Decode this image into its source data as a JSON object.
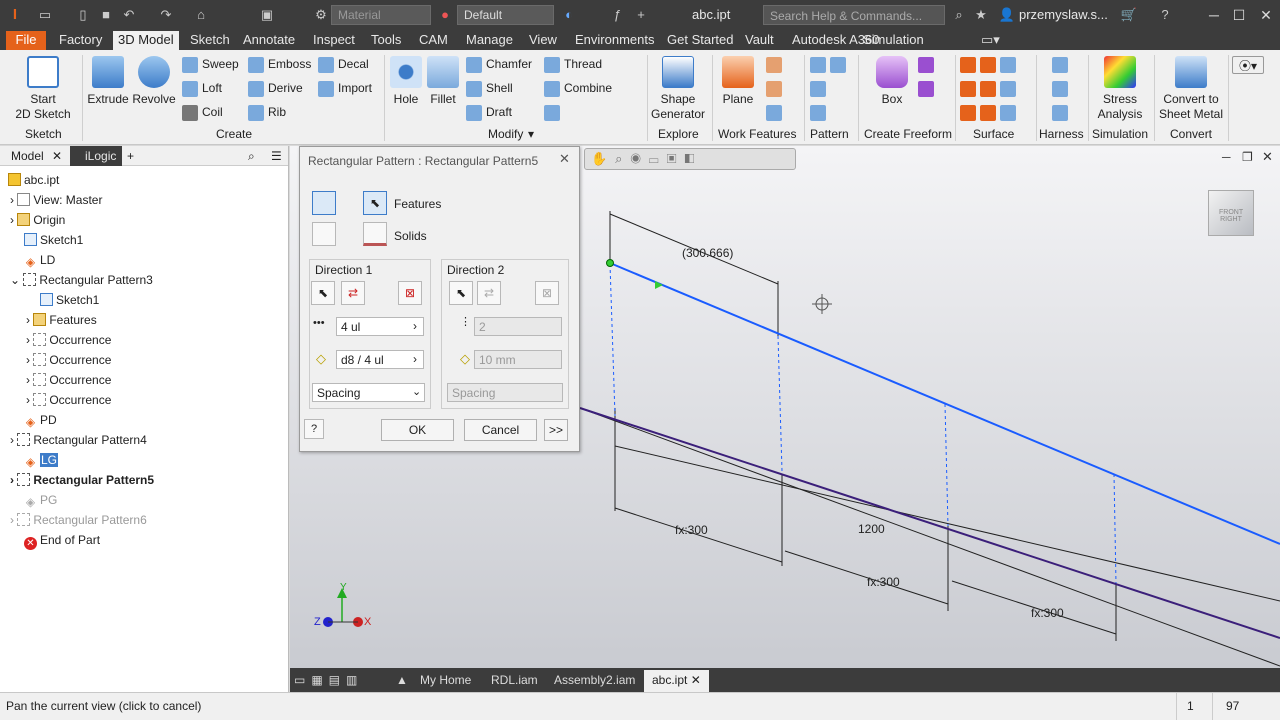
{
  "titlebar": {
    "material_placeholder": "Material",
    "appearance": "Default",
    "file_title": "abc.ipt",
    "search_placeholder": "Search Help & Commands...",
    "user": "przemyslaw.s..."
  },
  "tabs": [
    "File",
    "Factory",
    "3D Model",
    "Sketch",
    "Annotate",
    "Inspect",
    "Tools",
    "CAM",
    "Manage",
    "View",
    "Environments",
    "Get Started",
    "Vault",
    "Autodesk A360",
    "Simulation"
  ],
  "active_tab": "3D Model",
  "ribbon": {
    "sketch": {
      "start_line1": "Start",
      "start_line2": "2D Sketch",
      "panel": "Sketch"
    },
    "create": {
      "extrude": "Extrude",
      "revolve": "Revolve",
      "sweep": "Sweep",
      "loft": "Loft",
      "coil": "Coil",
      "emboss": "Emboss",
      "derive": "Derive",
      "rib": "Rib",
      "decal": "Decal",
      "import": "Import",
      "panel": "Create"
    },
    "modify": {
      "hole": "Hole",
      "fillet": "Fillet",
      "chamfer": "Chamfer",
      "shell": "Shell",
      "draft": "Draft",
      "thread": "Thread",
      "combine": "Combine",
      "panel": "Modify"
    },
    "explore": {
      "shape_line1": "Shape",
      "shape_line2": "Generator",
      "panel": "Explore"
    },
    "work": {
      "plane": "Plane",
      "panel": "Work Features"
    },
    "pattern": {
      "panel": "Pattern"
    },
    "freeform": {
      "box": "Box",
      "panel": "Create Freeform"
    },
    "surface": {
      "panel": "Surface"
    },
    "harness": {
      "panel": "Harness"
    },
    "simulation": {
      "stress_line1": "Stress",
      "stress_line2": "Analysis",
      "panel": "Simulation"
    },
    "convert": {
      "line1": "Convert to",
      "line2": "Sheet Metal",
      "panel": "Convert"
    }
  },
  "browser": {
    "tab_model": "Model",
    "tab_ilogic": "iLogic",
    "nodes": [
      {
        "label": "abc.ipt"
      },
      {
        "label": "View: Master"
      },
      {
        "label": "Origin"
      },
      {
        "label": "Sketch1"
      },
      {
        "label": "LD"
      },
      {
        "label": "Rectangular Pattern3"
      },
      {
        "label": "Sketch1"
      },
      {
        "label": "Features"
      },
      {
        "label": "Occurrence"
      },
      {
        "label": "Occurrence"
      },
      {
        "label": "Occurrence"
      },
      {
        "label": "Occurrence"
      },
      {
        "label": "PD"
      },
      {
        "label": "Rectangular Pattern4"
      },
      {
        "label": "LG"
      },
      {
        "label": "Rectangular Pattern5"
      },
      {
        "label": "PG"
      },
      {
        "label": "Rectangular Pattern6"
      },
      {
        "label": "End of Part"
      }
    ]
  },
  "dialog": {
    "title": "Rectangular Pattern : Rectangular Pattern5",
    "features": "Features",
    "solids": "Solids",
    "dir1": "Direction 1",
    "dir2": "Direction 2",
    "d1_count": "4 ul",
    "d1_spacing": "d8 / 4 ul",
    "d1_mode": "Spacing",
    "d2_count": "2",
    "d2_spacing": "10 mm",
    "d2_mode": "Spacing",
    "ok": "OK",
    "cancel": "Cancel",
    "more": ">>"
  },
  "viewport": {
    "dims": [
      "(300.666)",
      "fx:300",
      "1200",
      "fx:300",
      "fx:300"
    ],
    "cube_front": "FRONT",
    "cube_right": "RIGHT",
    "axis_x": "X",
    "axis_y": "Y",
    "axis_z": "Z"
  },
  "doc_tabs": [
    "My Home",
    "RDL.iam",
    "Assembly2.iam",
    "abc.ipt"
  ],
  "status": {
    "message": "Pan the current view (click to cancel)",
    "count1": "1",
    "count2": "97"
  },
  "colors": {
    "accent": "#e5621b",
    "sketch_line": "#1a5cff",
    "edge_line": "#3b1f7a"
  }
}
